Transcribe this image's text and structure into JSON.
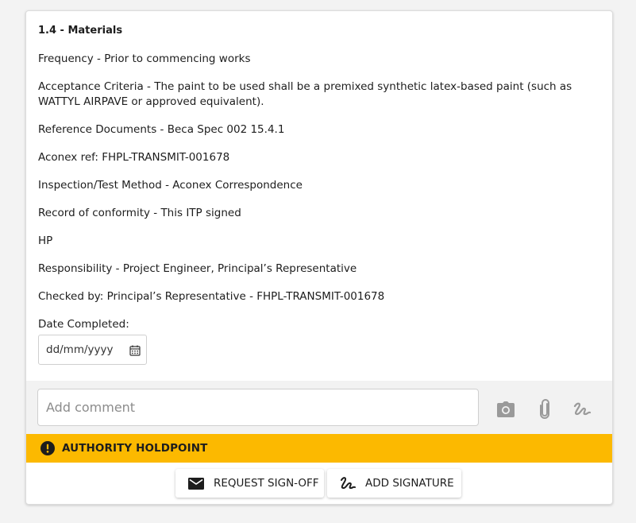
{
  "section": {
    "title": "1.4 - Materials",
    "frequency": "Frequency - Prior to commencing works",
    "acceptance": "Acceptance Criteria - The paint to be used shall be a premixed synthetic latex-based paint (such as WATTYL AIRPAVE or approved equivalent).",
    "reference": "Reference Documents - Beca Spec 002 15.4.1",
    "aconex": "Aconex ref: FHPL-TRANSMIT-001678",
    "inspection": "Inspection/Test Method - Aconex Correspondence",
    "record": "Record of conformity - This ITP signed",
    "hp": "HP",
    "responsibility": "Responsibility - Project Engineer, Principal’s Representative",
    "checked": "Checked by: Principal’s Representative - FHPL-TRANSMIT-001678",
    "date_label": "Date Completed:",
    "date_placeholder": "dd/mm/yyyy"
  },
  "comment": {
    "placeholder": "Add comment",
    "icons": [
      "camera-icon",
      "paperclip-icon",
      "signature-icon"
    ]
  },
  "holdpoint": {
    "label": "AUTHORITY HOLDPOINT",
    "color": "#fcb900"
  },
  "actions": {
    "request_signoff": "REQUEST SIGN-OFF",
    "add_signature": "ADD SIGNATURE"
  }
}
